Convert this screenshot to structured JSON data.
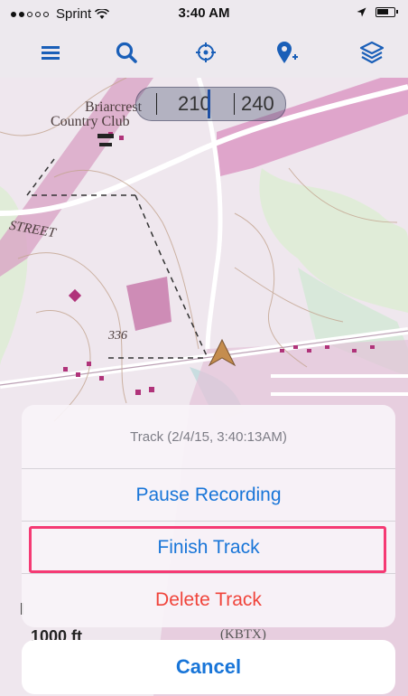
{
  "status": {
    "carrier": "Sprint",
    "time": "3:40 AM"
  },
  "toolbar": {
    "icons": [
      "menu-icon",
      "search-icon",
      "locate-icon",
      "add-pin-icon",
      "layers-icon"
    ]
  },
  "map": {
    "place_label_1": "Briarcrest",
    "place_label_2": "Country Club",
    "street_label": "STREET",
    "elevation_label": "336",
    "compass": {
      "heading_1": "210",
      "heading_2": "240"
    },
    "scale_text": "1000 ft",
    "bottom_left_char": "I",
    "airport_text": "(KBTX)"
  },
  "action_sheet": {
    "title": "Track (2/4/15, 3:40:13AM)",
    "pause_label": "Pause Recording",
    "finish_label": "Finish Track",
    "delete_label": "Delete Track",
    "cancel_label": "Cancel"
  },
  "colors": {
    "accent": "#1875d8",
    "destructive": "#f0443b",
    "highlight": "#f53a74"
  }
}
